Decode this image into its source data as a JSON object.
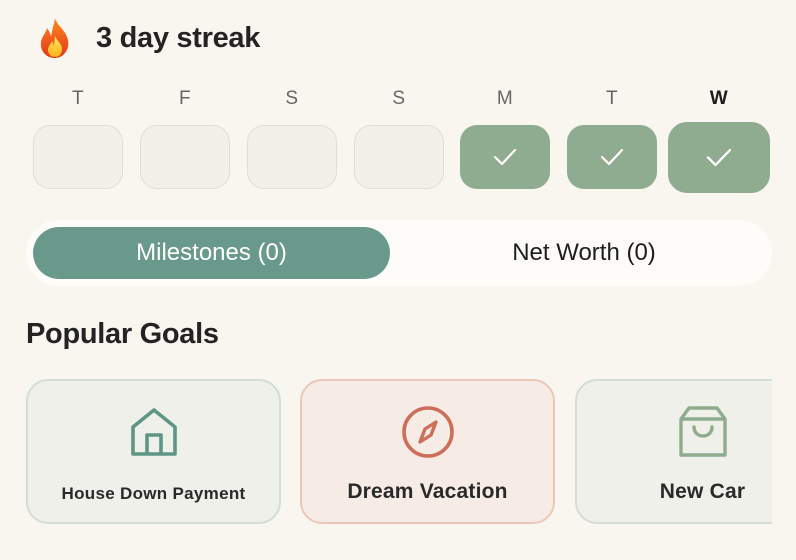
{
  "streak": {
    "icon": "fire-icon",
    "title": "3 day streak"
  },
  "days": [
    {
      "letter": "T",
      "done": false,
      "today": false
    },
    {
      "letter": "F",
      "done": false,
      "today": false
    },
    {
      "letter": "S",
      "done": false,
      "today": false
    },
    {
      "letter": "S",
      "done": false,
      "today": false
    },
    {
      "letter": "M",
      "done": true,
      "today": false
    },
    {
      "letter": "T",
      "done": true,
      "today": false
    },
    {
      "letter": "W",
      "done": true,
      "today": true
    }
  ],
  "tabs": {
    "milestones": "Milestones (0)",
    "net_worth": "Net Worth (0)",
    "active": "milestones"
  },
  "popular_goals": {
    "title": "Popular Goals",
    "items": [
      {
        "label": "House Down Payment",
        "icon": "house-icon"
      },
      {
        "label": "Dream Vacation",
        "icon": "compass-icon"
      },
      {
        "label": "New Car",
        "icon": "shopping-bag-icon"
      }
    ]
  },
  "colors": {
    "background": "#f9f6f0",
    "accent_green": "#68998a",
    "check_green": "#8fab90",
    "vacation_accent": "#cc6e5a",
    "icon_green": "#5f9585"
  }
}
